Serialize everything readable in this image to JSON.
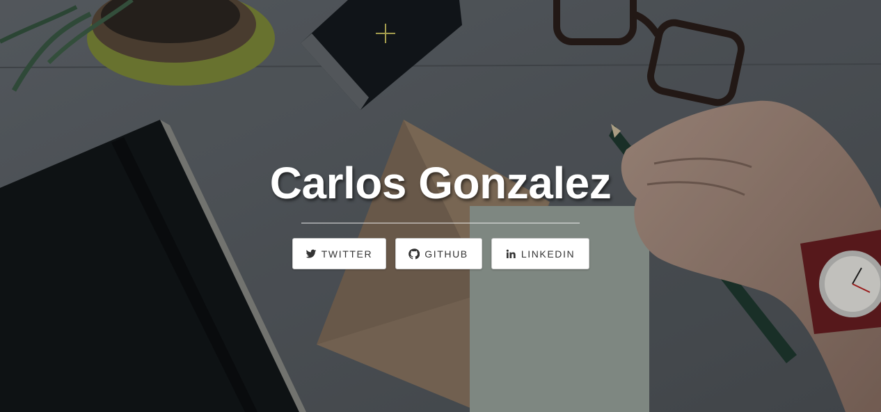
{
  "hero": {
    "name": "Carlos Gonzalez",
    "social_buttons": [
      {
        "label": "TWITTER",
        "icon": "twitter-icon"
      },
      {
        "label": "GITHUB",
        "icon": "github-icon"
      },
      {
        "label": "LINKEDIN",
        "icon": "linkedin-icon"
      }
    ]
  },
  "colors": {
    "desk": "#5b6066",
    "overlay": "#000000",
    "button_bg": "#ffffff",
    "button_text": "#333333"
  }
}
